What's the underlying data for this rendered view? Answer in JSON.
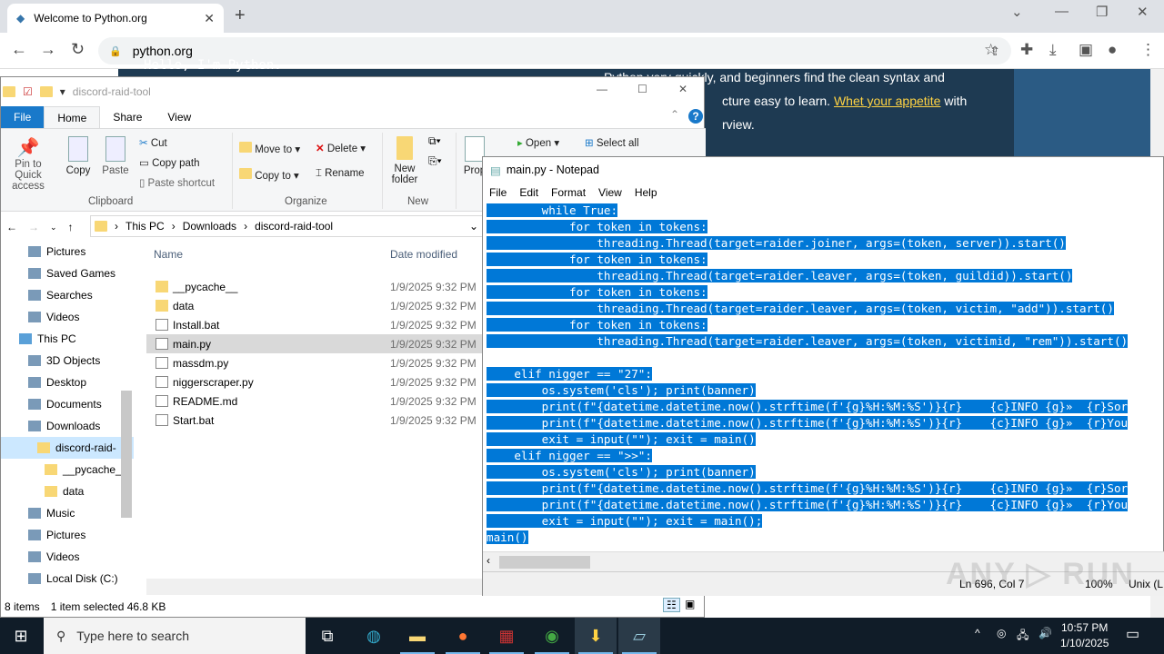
{
  "browser": {
    "tab_title": "Welcome to Python.org",
    "url": "python.org"
  },
  "webpage": {
    "hello_text": "Hello, I'm Python.",
    "line1": "Python very quickly, and beginners find the clean syntax and",
    "line2_pre": "cture easy to learn. ",
    "link": "Whet your appetite",
    "line2_post": " with",
    "line3": "rview."
  },
  "explorer": {
    "title": "discord-raid-tool",
    "tabs": [
      "File",
      "Home",
      "Share",
      "View"
    ],
    "ribbon": {
      "pin": "Pin to Quick access",
      "copy": "Copy",
      "paste": "Paste",
      "cut": "Cut",
      "copy_path": "Copy path",
      "paste_shortcut": "Paste shortcut",
      "clipboard": "Clipboard",
      "move_to": "Move to",
      "copy_to": "Copy to",
      "delete": "Delete",
      "rename": "Rename",
      "organize": "Organize",
      "new_folder": "New folder",
      "new": "New",
      "properties": "Prop",
      "open": "Open",
      "select_all": "Select all"
    },
    "path": [
      "This PC",
      "Downloads",
      "discord-raid-tool"
    ],
    "nav": [
      "Pictures",
      "Saved Games",
      "Searches",
      "Videos",
      "This PC",
      "3D Objects",
      "Desktop",
      "Documents",
      "Downloads",
      "discord-raid-",
      "__pycache_",
      "data",
      "Music",
      "Pictures",
      "Videos",
      "Local Disk (C:)"
    ],
    "columns": {
      "name": "Name",
      "date": "Date modified"
    },
    "files": [
      {
        "name": "__pycache__",
        "date": "1/9/2025 9:32 PM",
        "type": "folder"
      },
      {
        "name": "data",
        "date": "1/9/2025 9:32 PM",
        "type": "folder"
      },
      {
        "name": "Install.bat",
        "date": "1/9/2025 9:32 PM",
        "type": "bat"
      },
      {
        "name": "main.py",
        "date": "1/9/2025 9:32 PM",
        "type": "file",
        "selected": true
      },
      {
        "name": "massdm.py",
        "date": "1/9/2025 9:32 PM",
        "type": "file"
      },
      {
        "name": "niggerscraper.py",
        "date": "1/9/2025 9:32 PM",
        "type": "file"
      },
      {
        "name": "README.md",
        "date": "1/9/2025 9:32 PM",
        "type": "file"
      },
      {
        "name": "Start.bat",
        "date": "1/9/2025 9:32 PM",
        "type": "bat"
      }
    ],
    "status": {
      "items": "8 items",
      "selected": "1 item selected  46.8 KB"
    }
  },
  "notepad": {
    "title": "main.py - Notepad",
    "menu": [
      "File",
      "Edit",
      "Format",
      "View",
      "Help"
    ],
    "lines": [
      "        while True:",
      "            for token in tokens:",
      "                threading.Thread(target=raider.joiner, args=(token, server)).start()",
      "            for token in tokens:",
      "                threading.Thread(target=raider.leaver, args=(token, guildid)).start()",
      "            for token in tokens:",
      "                threading.Thread(target=raider.leaver, args=(token, victim, \"add\")).start()",
      "            for token in tokens:",
      "                threading.Thread(target=raider.leaver, args=(token, victimid, \"rem\")).start()",
      "",
      "    elif nigger == \"27\":",
      "        os.system('cls'); print(banner)",
      "        print(f\"{datetime.datetime.now().strftime(f'{g}%H:%M:%S')}{r}    {c}INFO {g}»  {r}Sor",
      "        print(f\"{datetime.datetime.now().strftime(f'{g}%H:%M:%S')}{r}    {c}INFO {g}»  {r}You",
      "        exit = input(\"\"); exit = main()",
      "    elif nigger == \">>\":",
      "        os.system('cls'); print(banner)",
      "        print(f\"{datetime.datetime.now().strftime(f'{g}%H:%M:%S')}{r}    {c}INFO {g}»  {r}Sor",
      "        print(f\"{datetime.datetime.now().strftime(f'{g}%H:%M:%S')}{r}    {c}INFO {g}»  {r}You",
      "        exit = input(\"\"); exit = main();",
      "main()"
    ],
    "status": {
      "position": "Ln 696, Col 7",
      "zoom": "100%",
      "eol": "Unix (L"
    }
  },
  "taskbar": {
    "search_placeholder": "Type here to search",
    "time": "10:57 PM",
    "date": "1/10/2025"
  },
  "watermark": "ANY RUN",
  "colors": {
    "selection": "#0078d7",
    "python_navy": "#1e3a52",
    "taskbar": "#101c28",
    "link": "#ffd343"
  }
}
